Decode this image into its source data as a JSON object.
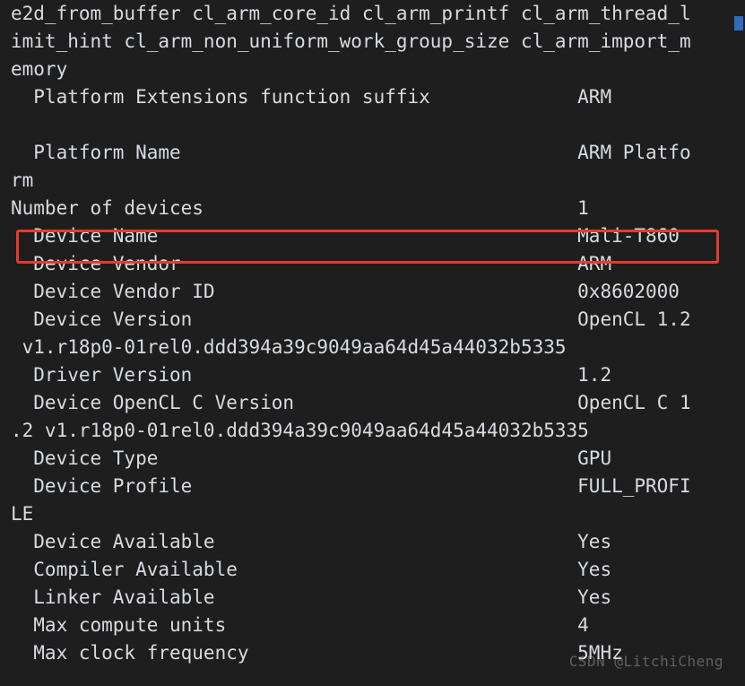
{
  "lines": [
    "e2d_from_buffer cl_arm_core_id cl_arm_printf cl_arm_thread_l",
    "imit_hint cl_arm_non_uniform_work_group_size cl_arm_import_m",
    "emory",
    "  Platform Extensions function suffix             ARM",
    "",
    "  Platform Name                                   ARM Platfo",
    "rm",
    "Number of devices                                 1",
    "  Device Name                                     Mali-T860",
    "  Device Vendor                                   ARM",
    "  Device Vendor ID                                0x8602000",
    "  Device Version                                  OpenCL 1.2",
    " v1.r18p0-01rel0.ddd394a39c9049aa64d45a44032b5335",
    "  Driver Version                                  1.2",
    "  Device OpenCL C Version                         OpenCL C 1",
    ".2 v1.r18p0-01rel0.ddd394a39c9049aa64d45a44032b5335",
    "  Device Type                                     GPU",
    "  Device Profile                                  FULL_PROFI",
    "LE",
    "  Device Available                                Yes",
    "  Compiler Available                              Yes",
    "  Linker Available                                Yes",
    "  Max compute units                               4",
    "  Max clock frequency                             5MHz"
  ],
  "watermark": "CSDN @LitchiCheng"
}
